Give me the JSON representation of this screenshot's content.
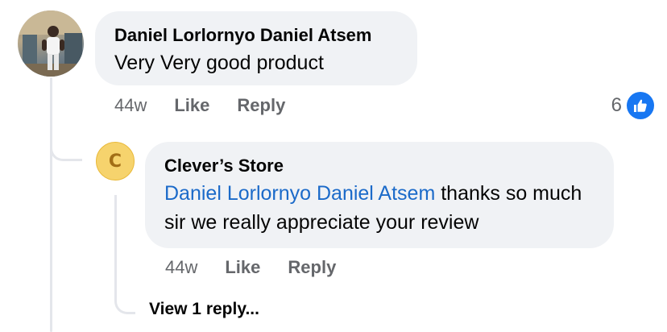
{
  "comment": {
    "author": "Daniel Lorlornyo Daniel Atsem",
    "text": "Very Very good product",
    "time": "44w",
    "like_label": "Like",
    "reply_label": "Reply",
    "reaction_count": "6",
    "reaction_icon": "thumbs-up-icon"
  },
  "reply": {
    "author": "Clever’s Store",
    "avatar_letter": "C",
    "mention": "Daniel Lorlornyo Daniel Atsem",
    "text": " thanks so much sir we really appreciate your review",
    "time": "44w",
    "like_label": "Like",
    "reply_label": "Reply"
  },
  "view_more_label": "View 1 reply...",
  "colors": {
    "bubble_bg": "#f0f2f5",
    "mention": "#1b6ac9",
    "like_blue": "#1877f2",
    "store_avatar": "#f6d36d"
  }
}
